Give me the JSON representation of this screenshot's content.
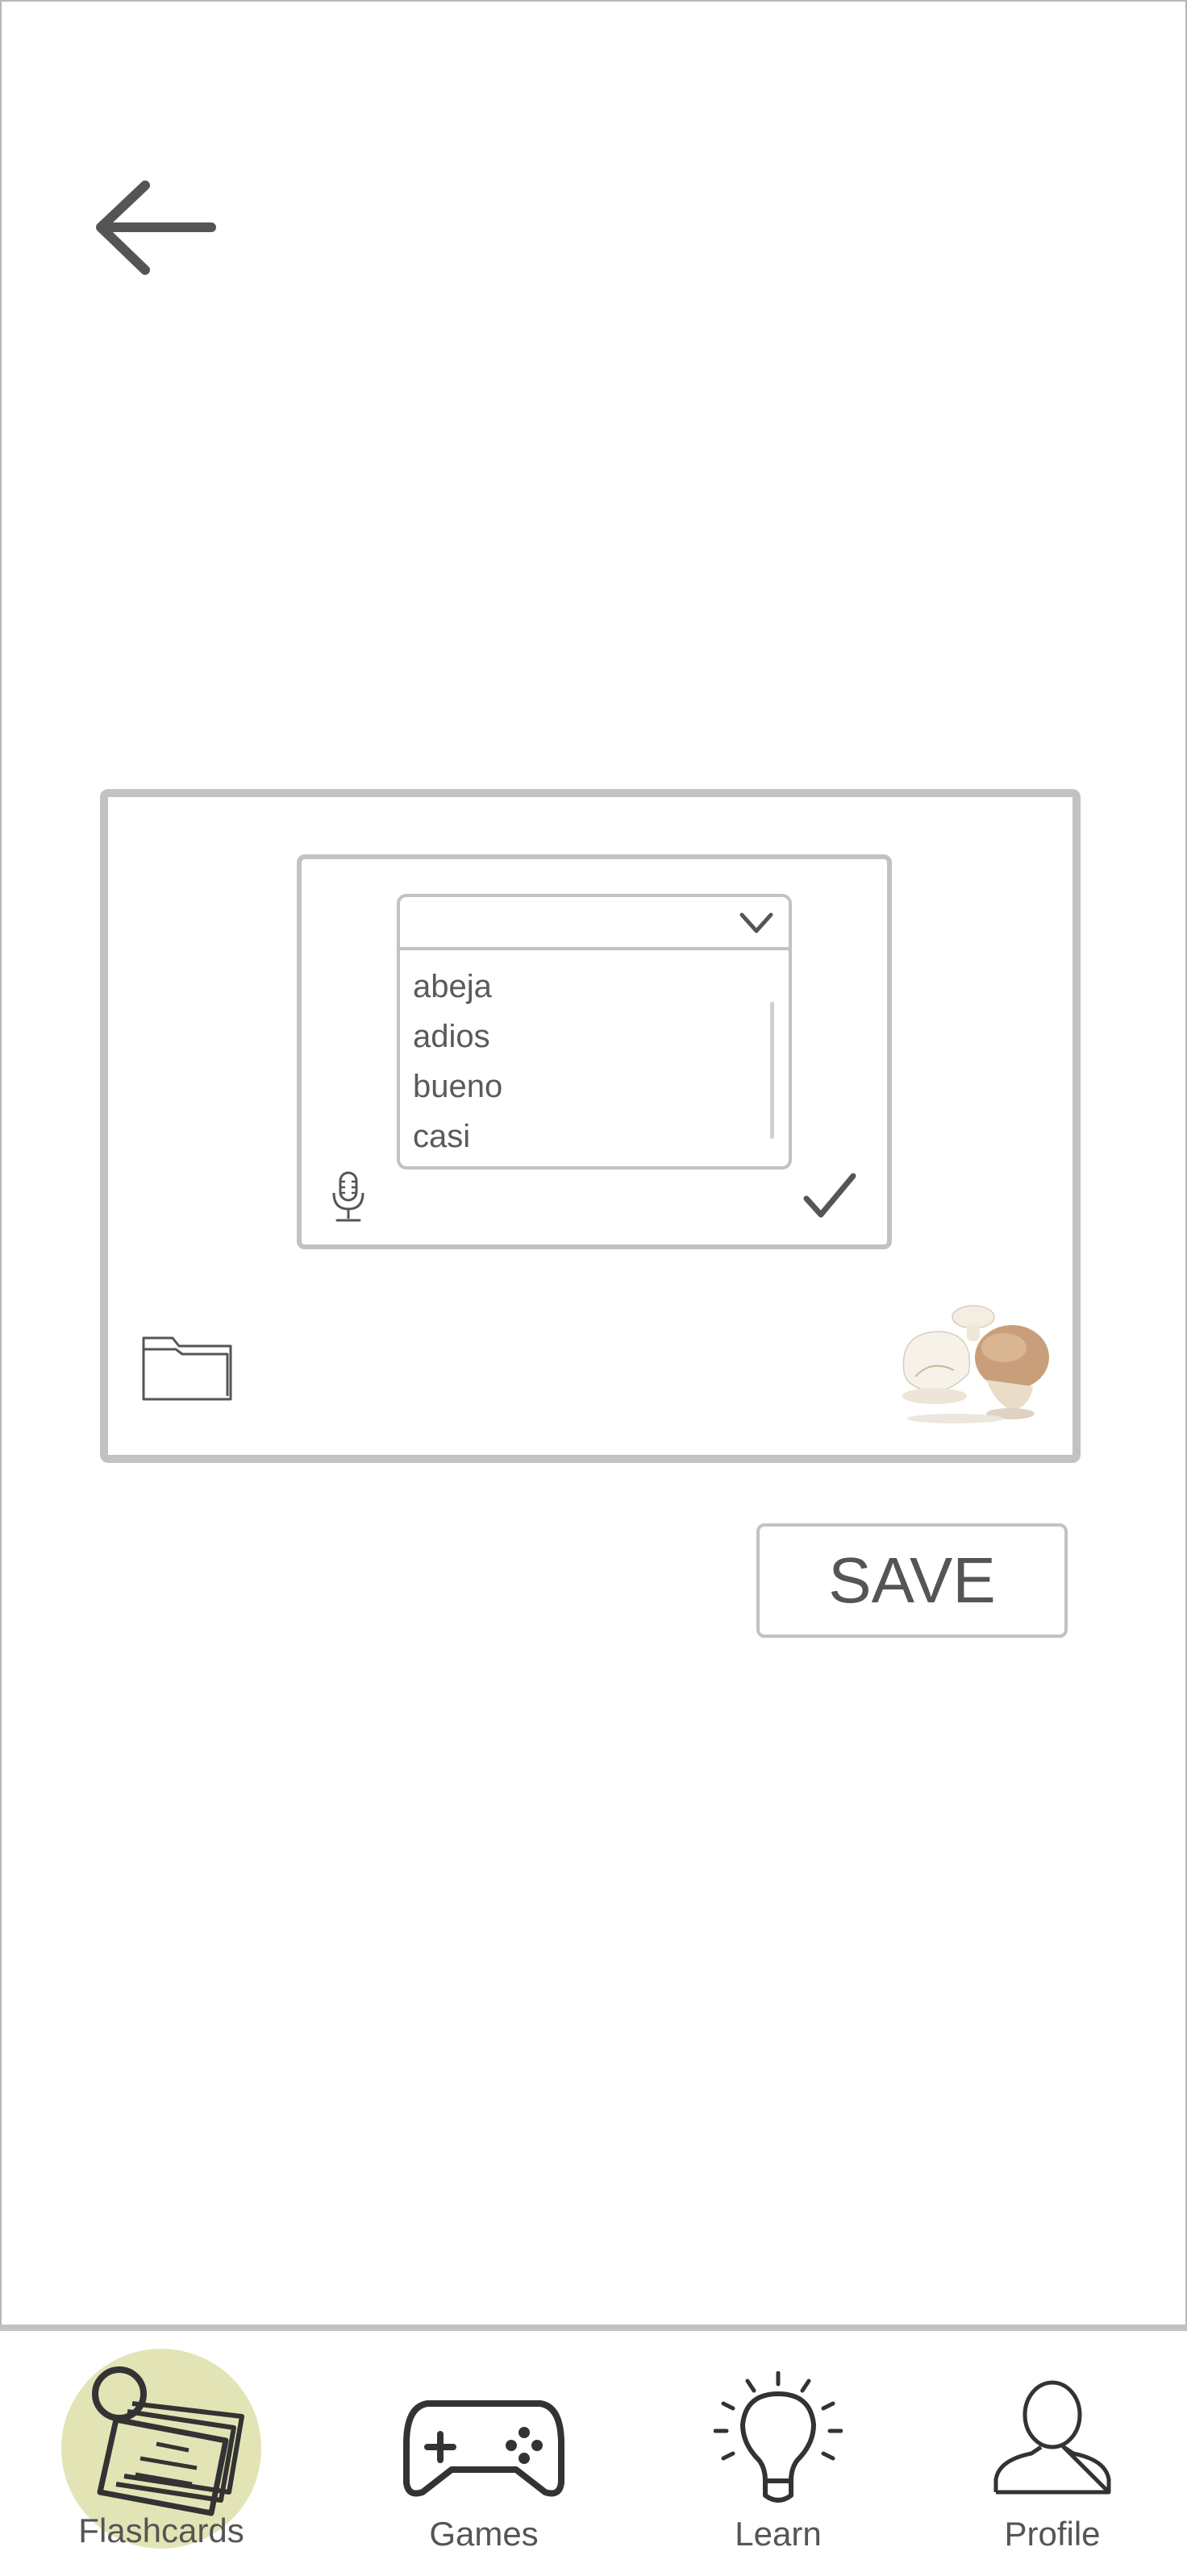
{
  "dropdown": {
    "selected": "",
    "options": [
      "abeja",
      "adios",
      "bueno",
      "casi"
    ]
  },
  "actions": {
    "save_label": "SAVE"
  },
  "nav": {
    "items": [
      {
        "label": "Flashcards",
        "icon": "flashcards-icon",
        "active": true
      },
      {
        "label": "Games",
        "icon": "gamepad-icon",
        "active": false
      },
      {
        "label": "Learn",
        "icon": "lightbulb-icon",
        "active": false
      },
      {
        "label": "Profile",
        "icon": "user-icon",
        "active": false
      }
    ]
  },
  "colors": {
    "border": "#c2c2c2",
    "text": "#555555",
    "active_highlight": "#e3e4b5"
  }
}
